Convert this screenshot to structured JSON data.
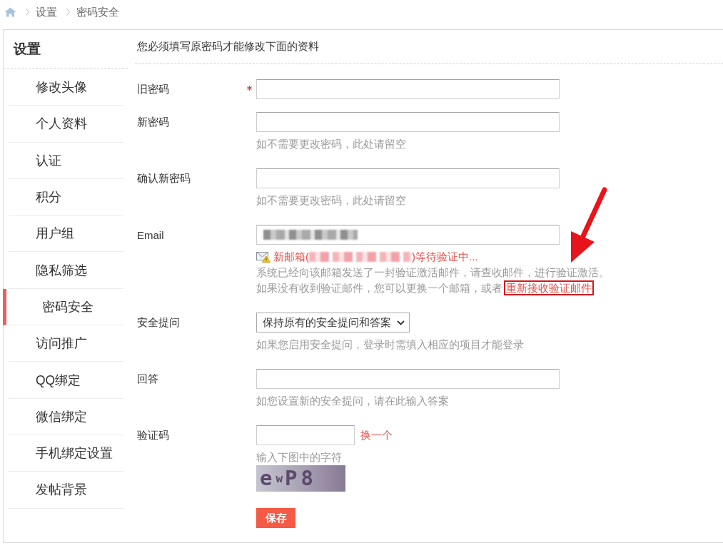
{
  "breadcrumb": [
    "设置",
    "密码安全"
  ],
  "sidebar": {
    "title": "设置",
    "items": [
      {
        "label": "修改头像",
        "selected": false
      },
      {
        "label": "个人资料",
        "selected": false
      },
      {
        "label": "认证",
        "selected": false
      },
      {
        "label": "积分",
        "selected": false
      },
      {
        "label": "用户组",
        "selected": false
      },
      {
        "label": "隐私筛选",
        "selected": false
      },
      {
        "label": "密码安全",
        "selected": true
      },
      {
        "label": "访问推广",
        "selected": false
      },
      {
        "label": "QQ绑定",
        "selected": false
      },
      {
        "label": "微信绑定",
        "selected": false
      },
      {
        "label": "手机绑定设置",
        "selected": false
      },
      {
        "label": "发帖背景",
        "selected": false
      }
    ]
  },
  "form": {
    "notice": "您必须填写原密码才能修改下面的资料",
    "rows": [
      {
        "kind": "input",
        "label": "旧密码",
        "required": true
      },
      {
        "kind": "input",
        "label": "新密码",
        "required": false,
        "hint": "如不需要更改密码，此处请留空"
      },
      {
        "kind": "input",
        "label": "确认新密码",
        "required": false,
        "hint": "如不需要更改密码，此处请留空"
      },
      {
        "kind": "email",
        "label": "Email",
        "required": false,
        "redacted": true,
        "status": {
          "prefix": "新邮箱(",
          "suffix": ")等待验证中...",
          "redacted": true
        },
        "info": "系统已经向该邮箱发送了一封验证激活邮件，请查收邮件，进行验证激活。",
        "resend": {
          "text": "如果没有收到验证邮件，您可以更换一个邮箱，或者",
          "link": "重新接收验证邮件",
          "highlighted": true
        }
      },
      {
        "kind": "select",
        "label": "安全提问",
        "required": false,
        "value": "保持原有的安全提问和答案",
        "hint": "如果您启用安全提问，登录时需填入相应的项目才能登录"
      },
      {
        "kind": "input",
        "label": "回答",
        "required": false,
        "hint": "如您设置新的安全提问，请在此输入答案"
      },
      {
        "kind": "captcha",
        "label": "验证码",
        "required": false,
        "refresh": "换一个",
        "hint": "输入下图中的字符",
        "captcha": "e$^{w}$P8"
      }
    ],
    "submit": "保存"
  }
}
